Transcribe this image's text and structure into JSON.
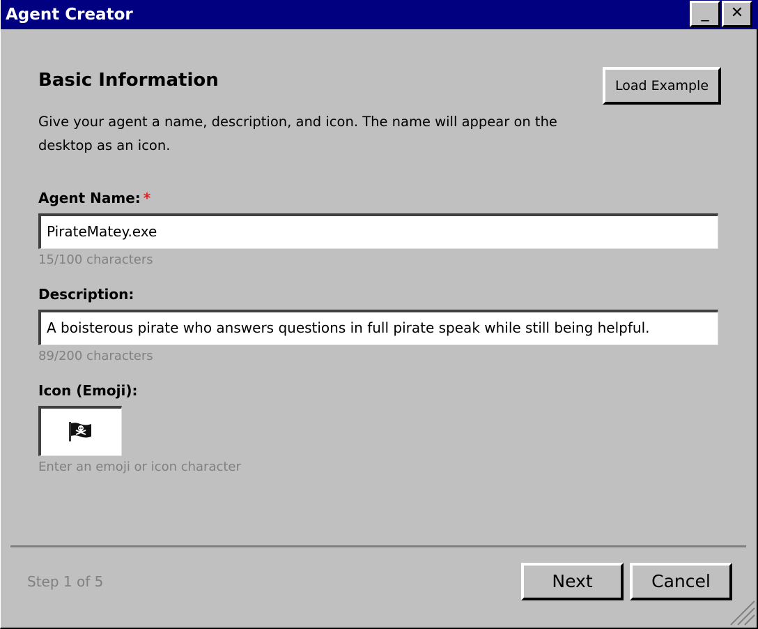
{
  "window": {
    "title": "Agent Creator",
    "minimize_label": "_",
    "close_label": "✕"
  },
  "section": {
    "heading": "Basic Information",
    "intro": "Give your agent a name, description, and icon. The name will appear on the desktop as an icon.",
    "load_example_label": "Load Example"
  },
  "fields": {
    "name": {
      "label": "Agent Name:",
      "required_marker": "*",
      "value": "PirateMatey.exe",
      "hint": "15/100 characters"
    },
    "description": {
      "label": "Description:",
      "value": "A boisterous pirate who answers questions in full pirate speak while still being helpful.",
      "hint": "89/200 characters"
    },
    "icon": {
      "label": "Icon (Emoji):",
      "value_icon": "pirate-flag-icon",
      "hint": "Enter an emoji or icon character"
    }
  },
  "footer": {
    "step": "Step 1 of 5",
    "next_label": "Next",
    "cancel_label": "Cancel"
  },
  "colors": {
    "titlebar": "#000080",
    "background": "#c0c0c0",
    "required": "#e02020",
    "hint_text": "#808080"
  }
}
